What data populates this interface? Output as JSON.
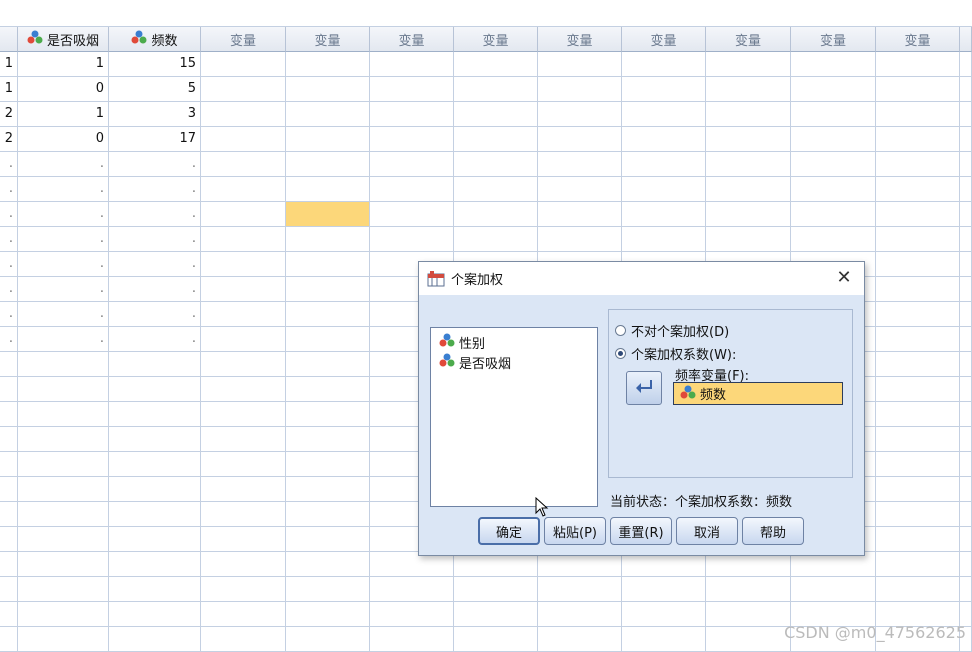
{
  "sheet": {
    "columns": [
      {
        "label": "",
        "icon": "none",
        "is_var": false
      },
      {
        "label": "是否吸烟",
        "icon": "nominal-variable-icon",
        "is_var": false
      },
      {
        "label": "频数",
        "icon": "nominal-variable-icon",
        "is_var": false
      },
      {
        "label": "变量",
        "icon": "none",
        "is_var": true
      },
      {
        "label": "变量",
        "icon": "none",
        "is_var": true
      },
      {
        "label": "变量",
        "icon": "none",
        "is_var": true
      },
      {
        "label": "变量",
        "icon": "none",
        "is_var": true
      },
      {
        "label": "变量",
        "icon": "none",
        "is_var": true
      },
      {
        "label": "变量",
        "icon": "none",
        "is_var": true
      },
      {
        "label": "变量",
        "icon": "none",
        "is_var": true
      },
      {
        "label": "变量",
        "icon": "none",
        "is_var": true
      },
      {
        "label": "变量",
        "icon": "none",
        "is_var": true
      }
    ],
    "rows": [
      [
        "1",
        "1",
        "15"
      ],
      [
        "1",
        "0",
        "5"
      ],
      [
        "2",
        "1",
        "3"
      ],
      [
        "2",
        "0",
        "17"
      ],
      [
        ".",
        ".",
        "."
      ],
      [
        ".",
        ".",
        "."
      ],
      [
        ".",
        ".",
        "."
      ],
      [
        ".",
        ".",
        "."
      ],
      [
        ".",
        ".",
        "."
      ],
      [
        ".",
        ".",
        "."
      ],
      [
        ".",
        ".",
        "."
      ],
      [
        ".",
        ".",
        "."
      ]
    ],
    "selected_cell": {
      "row": 6,
      "col": 4
    }
  },
  "dialog": {
    "title": "个案加权",
    "title_icon": "weight-cases-icon",
    "close_icon": "close-icon",
    "variables": [
      {
        "label": "性别",
        "icon": "nominal-variable-icon"
      },
      {
        "label": "是否吸烟",
        "icon": "nominal-variable-icon"
      }
    ],
    "options": [
      {
        "label": "不对个案加权(D)",
        "selected": false
      },
      {
        "label": "个案加权系数(W):",
        "selected": true
      }
    ],
    "move_icon": "move-arrow-icon",
    "freq_label": "频率变量(F):",
    "freq_value": "频数",
    "status": "当前状态：个案加权系数：频数",
    "buttons": {
      "ok": "确定",
      "paste": "粘贴(P)",
      "reset": "重置(R)",
      "cancel": "取消",
      "help": "帮助"
    }
  },
  "watermark": "CSDN @m0_47562625",
  "colors": {
    "selected_cell": "#fcd77a",
    "dialog_bg": "#dbe6f5"
  }
}
